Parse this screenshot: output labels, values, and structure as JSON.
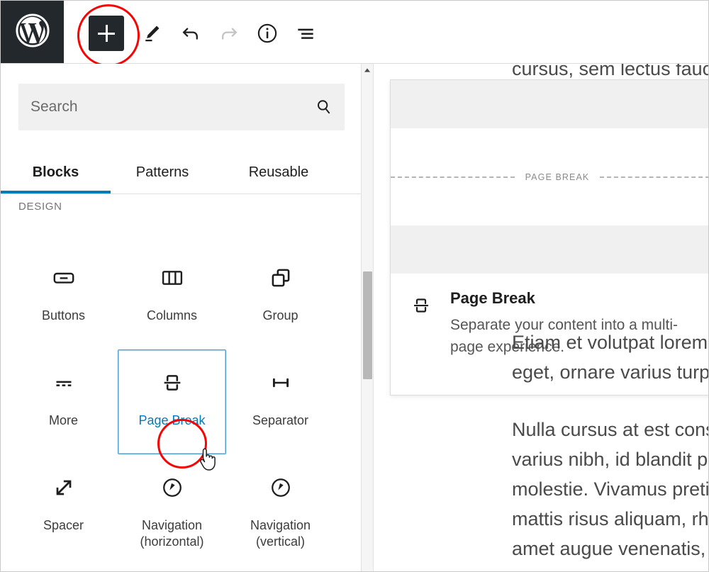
{
  "toolbar": {
    "wordpress_logo": "wordpress-logo",
    "add_block_label": "+",
    "add_block_name": "Toggle block inserter",
    "icons": [
      {
        "name": "edit-pencil-icon",
        "label": "Edit"
      },
      {
        "name": "undo-icon",
        "label": "Undo"
      },
      {
        "name": "redo-icon",
        "label": "Redo"
      },
      {
        "name": "info-icon",
        "label": "Details"
      },
      {
        "name": "list-view-icon",
        "label": "List view"
      }
    ]
  },
  "inserter": {
    "search": {
      "placeholder": "Search",
      "value": "",
      "icon": "search-icon"
    },
    "tabs": [
      {
        "label": "Blocks",
        "active": true
      },
      {
        "label": "Patterns",
        "active": false
      },
      {
        "label": "Reusable",
        "active": false
      }
    ],
    "section_title": "DESIGN",
    "blocks": [
      {
        "label": "Buttons",
        "icon": "buttons-icon",
        "selected": false
      },
      {
        "label": "Columns",
        "icon": "columns-icon",
        "selected": false
      },
      {
        "label": "Group",
        "icon": "group-icon",
        "selected": false
      },
      {
        "label": "More",
        "icon": "more-icon",
        "selected": false
      },
      {
        "label": "Page Break",
        "icon": "page-break-icon",
        "selected": true
      },
      {
        "label": "Separator",
        "icon": "separator-icon",
        "selected": false
      },
      {
        "label": "Spacer",
        "icon": "spacer-icon",
        "selected": false
      },
      {
        "label": "Navigation (horizontal)",
        "icon": "navigation-icon",
        "selected": false
      },
      {
        "label": "Navigation (vertical)",
        "icon": "navigation-icon",
        "selected": false
      }
    ]
  },
  "preview_card": {
    "page_break_divider_label": "PAGE BREAK",
    "icon": "page-break-icon",
    "title": "Page Break",
    "description": "Separate your content into a multi-page experience."
  },
  "editor": {
    "clipped_top_text": "cursus, sem lectus faucib",
    "paragraphs": [
      {
        "lines": [
          "Etiam et volutpat lorem.",
          "eget, ornare varius turpis"
        ]
      },
      {
        "lines": [
          "Nulla cursus at est conse",
          "varius nibh, id blandit pu",
          "molestie. Vivamus pretiu",
          "mattis risus aliquam, rho",
          "amet augue venenatis, fr"
        ]
      }
    ]
  },
  "scrollbar": {
    "up_arrow": "scroll-up-arrow-icon",
    "thumb": "scrollbar-thumb"
  },
  "annotations": {
    "highlight_color": "#f60505",
    "cursor": "pointing-hand-cursor"
  },
  "colors": {
    "accent": "#007cba",
    "dark_bar": "#23282d",
    "selected_border": "#4d9fd1",
    "red_circle": "#f60505"
  }
}
